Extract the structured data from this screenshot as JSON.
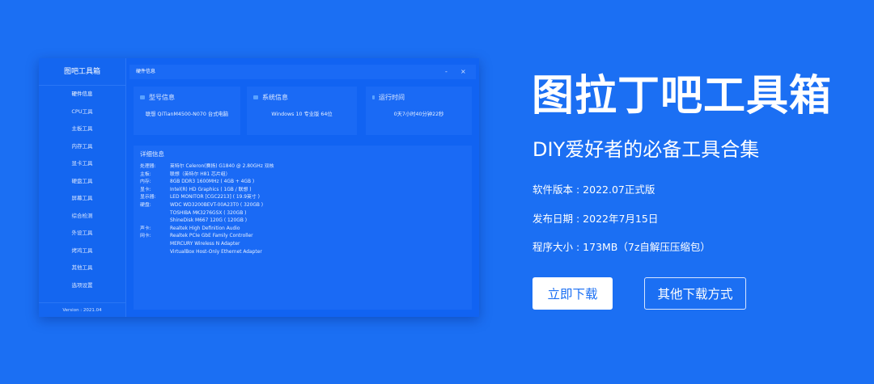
{
  "app": {
    "title": "图吧工具箱",
    "version": "Version : 2021.04",
    "sidebar": [
      "硬件信息",
      "CPU工具",
      "主板工具",
      "内存工具",
      "显卡工具",
      "硬盘工具",
      "屏幕工具",
      "综合检测",
      "外设工具",
      "烤鸡工具",
      "其他工具",
      "选项设置"
    ],
    "titlebar": {
      "title": "硬件信息",
      "minimize": "-",
      "close": "×"
    },
    "cards": [
      {
        "title": "型号信息",
        "value": "联想 QiTianM4500-N070 台式电脑"
      },
      {
        "title": "系统信息",
        "value": "Windows 10 专业版 64位"
      },
      {
        "title": "运行时间",
        "value": "0天7小时40分钟22秒"
      }
    ],
    "details": {
      "title": "详细信息",
      "rows": [
        {
          "k": "处理器:",
          "v": "英特尔 Celeron(赛扬) G1840 @ 2.80GHz 双核"
        },
        {
          "k": "主板:",
          "v": "联想（英特尔 H81 芯片组）"
        },
        {
          "k": "内存:",
          "v": "8GB DDR3 1600MHz ( 4GB + 4GB )"
        },
        {
          "k": "显卡:",
          "v": "Intel(R) HD Graphics ( 1GB / 联想 )"
        },
        {
          "k": "显示器:",
          "v": "LED MONITOR [CGC2213] ( 19.9英寸 )"
        },
        {
          "k": "硬盘:",
          "v": "WDC WD3200BEVT-00A23T0 ( 320GB )"
        },
        {
          "k": "",
          "v": "TOSHIBA MK3276GSX ( 320GB )"
        },
        {
          "k": "",
          "v": "ShineDisk M667 120G ( 120GB )"
        },
        {
          "k": "声卡:",
          "v": "Realtek High Definition Audio"
        },
        {
          "k": "网卡:",
          "v": "Realtek PCIe GbE Family Controller"
        },
        {
          "k": "",
          "v": "MERCURY Wireless N Adapter"
        },
        {
          "k": "",
          "v": "VirtualBox Host-Only Ethernet Adapter"
        }
      ]
    }
  },
  "promo": {
    "title": "图拉丁吧工具箱",
    "subtitle": "DIY爱好者的必备工具合集",
    "version": "软件版本 : 2022.07正式版",
    "date": "发布日期 : 2022年7月15日",
    "size": "程序大小 : 173MB（7z自解压压缩包）",
    "download": "立即下载",
    "other": "其他下载方式"
  }
}
